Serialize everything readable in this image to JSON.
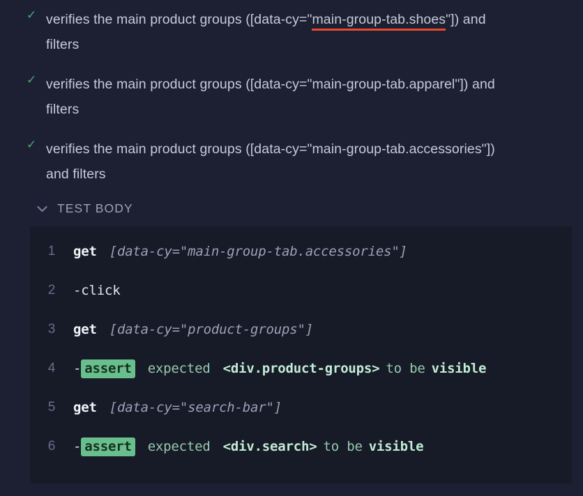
{
  "app": {
    "name": "cypress-test-runner",
    "background": "#1d2032",
    "code_background": "#171a27",
    "accent_pass": "#4ca86c",
    "accent_underline": "#e94b2b",
    "assert_badge_bg": "#68bf8d"
  },
  "tests": [
    {
      "status_icon": "check-icon",
      "status": "passed",
      "title_prefix": "verifies the main product groups ([data-cy=\"",
      "title_selector": "main-group-tab.shoes",
      "title_suffix": "\"]) and filters",
      "full_title": "verifies the main product groups ([data-cy=\"main-group-tab.shoes\"]) and filters",
      "highlighted": true
    },
    {
      "status_icon": "check-icon",
      "status": "passed",
      "title_prefix": "verifies the main product groups ([data-cy=\"",
      "title_selector": "main-group-tab.apparel",
      "title_suffix": "\"]) and filters",
      "full_title": "verifies the main product groups ([data-cy=\"main-group-tab.apparel\"]) and filters",
      "highlighted": false
    },
    {
      "status_icon": "check-icon",
      "status": "passed",
      "title_prefix": "verifies the main product groups ([data-cy=\"",
      "title_selector": "main-group-tab.accessories",
      "title_suffix": "\"]) and filters",
      "full_title": "verifies the main product groups ([data-cy=\"main-group-tab.accessories\"]) and filters",
      "highlighted": false
    }
  ],
  "test_body": {
    "chevron_icon": "chevron-down-icon",
    "label": "TEST BODY",
    "expanded": true,
    "commands": [
      {
        "number": "1",
        "type": "get",
        "name": "get",
        "argument": "[data-cy=\"main-group-tab.accessories\"]"
      },
      {
        "number": "2",
        "type": "click",
        "prefix": "-",
        "name": "click"
      },
      {
        "number": "3",
        "type": "get",
        "name": "get",
        "argument": "[data-cy=\"product-groups\"]"
      },
      {
        "number": "4",
        "type": "assert",
        "prefix": "-",
        "badge": "assert",
        "expected_word": "expected",
        "element": "<div.product-groups>",
        "connector": "to be",
        "state": "visible"
      },
      {
        "number": "5",
        "type": "get",
        "name": "get",
        "argument": "[data-cy=\"search-bar\"]"
      },
      {
        "number": "6",
        "type": "assert",
        "prefix": "-",
        "badge": "assert",
        "expected_word": "expected",
        "element": "<div.search>",
        "connector": "to be",
        "state": "visible"
      }
    ]
  }
}
